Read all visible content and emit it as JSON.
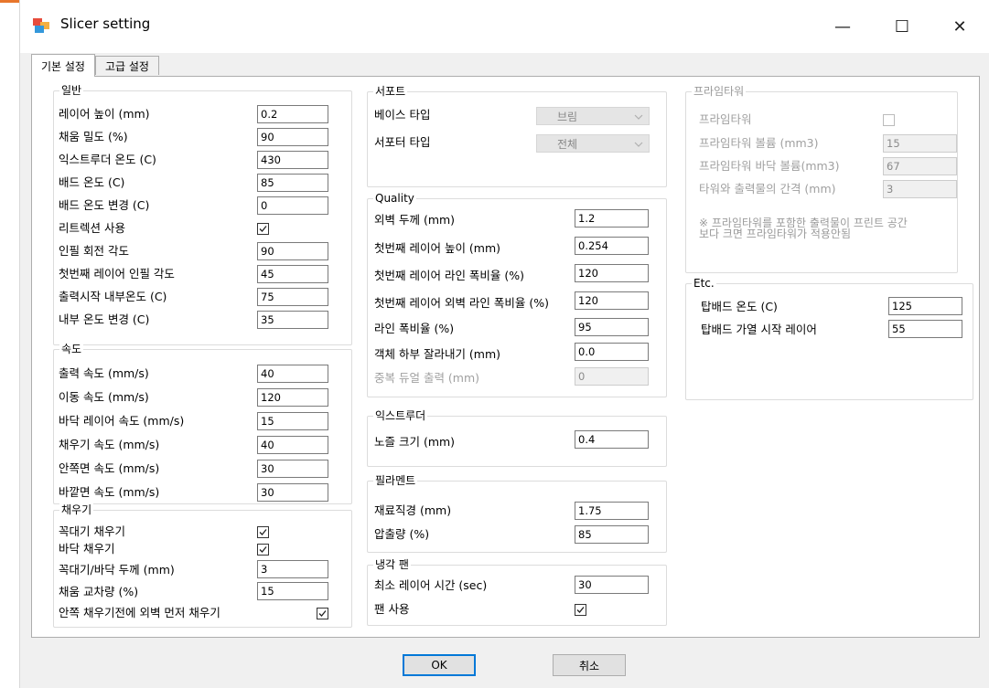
{
  "window": {
    "title": "Slicer setting",
    "minimize": "—",
    "maximize": "☐",
    "close": "✕"
  },
  "tabs": [
    {
      "label": "기본 설정",
      "active": true
    },
    {
      "label": "고급 설정",
      "active": false
    }
  ],
  "general": {
    "title": "일반",
    "fields": [
      {
        "label": "레이어 높이 (mm)",
        "value": "0.2"
      },
      {
        "label": "채움 밀도 (%)",
        "value": "90"
      },
      {
        "label": "익스트루더 온도 (C)",
        "value": "430"
      },
      {
        "label": "배드 온도 (C)",
        "value": "85"
      },
      {
        "label": "배드 온도 변경 (C)",
        "value": "0"
      },
      {
        "label": "리트렉션 사용",
        "checked": true
      },
      {
        "label": "인필 회전 각도",
        "value": "90"
      },
      {
        "label": "첫번째 레이어 인필 각도",
        "value": "45"
      },
      {
        "label": "출력시작 내부온도 (C)",
        "value": "75"
      },
      {
        "label": "내부 온도 변경 (C)",
        "value": "35"
      }
    ]
  },
  "speed": {
    "title": "속도",
    "fields": [
      {
        "label": "출력 속도 (mm/s)",
        "value": "40"
      },
      {
        "label": "이동 속도 (mm/s)",
        "value": "120"
      },
      {
        "label": "바닥 레이어 속도 (mm/s)",
        "value": "15"
      },
      {
        "label": "채우기 속도 (mm/s)",
        "value": "40"
      },
      {
        "label": "안쪽면 속도 (mm/s)",
        "value": "30"
      },
      {
        "label": "바깥면 속도 (mm/s)",
        "value": "30"
      }
    ]
  },
  "fill": {
    "title": "채우기",
    "fields": [
      {
        "label": "꼭대기 채우기",
        "checked": true
      },
      {
        "label": "바닥 채우기",
        "checked": true
      },
      {
        "label": "꼭대기/바닥 두께 (mm)",
        "value": "3"
      },
      {
        "label": "채움 교차량 (%)",
        "value": "15"
      },
      {
        "label": "안쪽 채우기전에 외벽 먼저 채우기",
        "checked": true
      }
    ]
  },
  "support": {
    "title": "서포트",
    "base_label": "베이스 타입",
    "base_value": "브림",
    "support_label": "서포터 타입",
    "support_value": "전체"
  },
  "quality": {
    "title": "Quality",
    "fields": [
      {
        "label": "외벽 두께 (mm)",
        "value": "1.2"
      },
      {
        "label": "첫번째 레이어 높이 (mm)",
        "value": "0.254"
      },
      {
        "label": "첫번째 레이어 라인 폭비율 (%)",
        "value": "120"
      },
      {
        "label": "첫번째 레이어 외벽 라인 폭비율 (%)",
        "value": "120"
      },
      {
        "label": "라인 폭비율 (%)",
        "value": "95"
      },
      {
        "label": "객체 하부 잘라내기 (mm)",
        "value": "0.0"
      },
      {
        "label": "중복 듀얼 출력 (mm)",
        "value": "0",
        "disabled": true
      }
    ]
  },
  "extruder": {
    "title": "익스트루더",
    "label": "노즐 크기 (mm)",
    "value": "0.4"
  },
  "filament": {
    "title": "필라멘트",
    "fields": [
      {
        "label": "재료직경 (mm)",
        "value": "1.75"
      },
      {
        "label": "압출량 (%)",
        "value": "85"
      }
    ]
  },
  "cooling": {
    "title": "냉각 팬",
    "time_label": "최소 레이어 시간 (sec)",
    "time_value": "30",
    "fan_label": "팬 사용",
    "fan_checked": true
  },
  "prime": {
    "title": "프라임타워",
    "enable_label": "프라임타워",
    "fields": [
      {
        "label": "프라임타워 볼륨 (mm3)",
        "value": "15"
      },
      {
        "label": "프라임타워 바닥 볼륨(mm3)",
        "value": "67"
      },
      {
        "label": "타워와 출력물의 간격 (mm)",
        "value": "3"
      }
    ],
    "note_line1": "※ 프라임타워를 포함한 출력물이 프린트 공간",
    "note_line2": "보다 크면 프라임타워가 적용안됨"
  },
  "etc": {
    "title": "Etc.",
    "fields": [
      {
        "label": "탑배드 온도 (C)",
        "value": "125"
      },
      {
        "label": "탑배드 가열 시작 레이어",
        "value": "55"
      }
    ]
  },
  "buttons": {
    "ok": "OK",
    "cancel": "취소"
  }
}
